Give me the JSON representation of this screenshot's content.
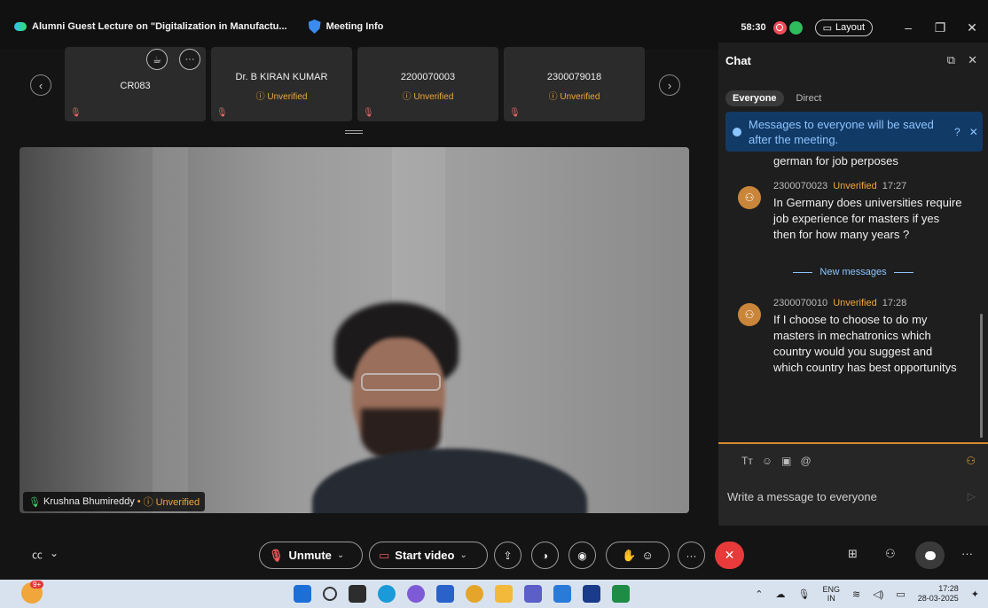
{
  "window": {
    "title": "Alumni Guest Lecture on \"Digitalization in Manufactu...",
    "meeting_info": "Meeting Info",
    "timer": "58:30",
    "layout_label": "Layout",
    "controls": {
      "minimize": "–",
      "restore": "❐",
      "close": "✕"
    }
  },
  "participants": [
    {
      "name": "CR083",
      "unverified": "",
      "has_controls": true
    },
    {
      "name": "Dr. B KIRAN KUMAR",
      "unverified": "ⓘ Unverified"
    },
    {
      "name": "2200070003",
      "unverified": "ⓘ Unverified"
    },
    {
      "name": "2300079018",
      "unverified": "ⓘ Unverified"
    }
  ],
  "strip": {
    "prev": "‹",
    "next": "›"
  },
  "speaker": {
    "name": "Krushna Bhumireddy",
    "separator": "•",
    "status": "ⓘ Unverified"
  },
  "chat": {
    "title": "Chat",
    "tabs": [
      "Everyone",
      "Direct"
    ],
    "notice": "Messages to everyone will be saved after the meeting.",
    "prev_text": "german for job perposes",
    "messages": [
      {
        "sender": "2300070023",
        "status": "Unverified",
        "time": "17:27",
        "text": "In Germany does universities require job experience for masters if yes then for how many years ?"
      },
      {
        "sender": "2300070010",
        "status": "Unverified",
        "time": "17:28",
        "text": "If I choose to choose to do my masters in mechatronics which country would you suggest and which country has best opportunitys"
      }
    ],
    "new_messages": "New messages",
    "composer_placeholder": "Write a message to everyone"
  },
  "controls": {
    "unmute": "Unmute",
    "start_video": "Start video"
  },
  "taskbar": {
    "badge": "9+",
    "lang_top": "ENG",
    "lang_bottom": "IN",
    "time": "17:28",
    "date": "28-03-2025"
  },
  "colors": {
    "accent_orange": "#f0a63a",
    "end_call_red": "#e83a3a",
    "notice_blue": "#123a66"
  }
}
